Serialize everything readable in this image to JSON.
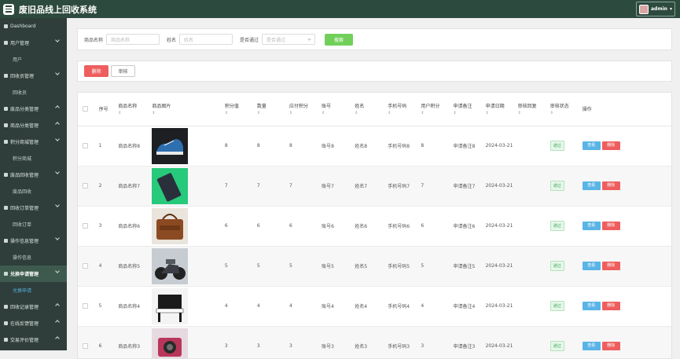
{
  "app": {
    "title": "废旧品线上回收系统",
    "user": "admin"
  },
  "sidebar": {
    "items": [
      {
        "label": "Dashboard",
        "type": "item",
        "icon": "home-icon"
      },
      {
        "label": "用户管理",
        "type": "group",
        "open": true
      },
      {
        "label": "用户",
        "type": "sub"
      },
      {
        "label": "回收员管理",
        "type": "group",
        "open": true
      },
      {
        "label": "回收员",
        "type": "sub"
      },
      {
        "label": "废品分类管理",
        "type": "group",
        "open": false
      },
      {
        "label": "商品分类管理",
        "type": "group",
        "open": false
      },
      {
        "label": "积分商城管理",
        "type": "group",
        "open": true
      },
      {
        "label": "积分商城",
        "type": "sub"
      },
      {
        "label": "废品回收管理",
        "type": "group",
        "open": true
      },
      {
        "label": "废品回收",
        "type": "sub"
      },
      {
        "label": "回收订单管理",
        "type": "group",
        "open": true
      },
      {
        "label": "回收订单",
        "type": "sub"
      },
      {
        "label": "操作信息管理",
        "type": "group",
        "open": true
      },
      {
        "label": "操作信息",
        "type": "sub"
      },
      {
        "label": "兑换申请管理",
        "type": "group",
        "open": true,
        "active": true
      },
      {
        "label": "兑换申请",
        "type": "sub",
        "active": true
      },
      {
        "label": "回收记录管理",
        "type": "group",
        "open": false
      },
      {
        "label": "在线反馈管理",
        "type": "group",
        "open": false
      },
      {
        "label": "交易评价管理",
        "type": "group",
        "open": false
      }
    ]
  },
  "search": {
    "name_label": "商品名称",
    "name_placeholder": "商品名称",
    "person_label": "姓名",
    "person_placeholder": "姓名",
    "pass_label": "是否通过",
    "pass_placeholder": "是否通过",
    "search_button": "搜索"
  },
  "actions": {
    "delete": "删除",
    "review": "审核"
  },
  "table": {
    "headers": [
      "序号",
      "商品名称",
      "商品图片",
      "积分值",
      "数量",
      "应付积分",
      "账号",
      "姓名",
      "手机号码",
      "用户积分",
      "申请备注",
      "申请日期",
      "审核回复",
      "审核状态",
      "操作"
    ],
    "sort_glyph": "⇕",
    "rows": [
      {
        "idx": "1",
        "name": "商品名称8",
        "img": "sneaker",
        "pts": "8",
        "qty": "8",
        "pay": "8",
        "acct": "账号8",
        "person": "姓名8",
        "phone": "手机号码8",
        "upts": "8",
        "note": "申请备注8",
        "date": "2024-03-21",
        "reply": "",
        "status": "通过"
      },
      {
        "idx": "2",
        "name": "商品名称7",
        "img": "tablet",
        "pts": "7",
        "qty": "7",
        "pay": "7",
        "acct": "账号7",
        "person": "姓名7",
        "phone": "手机号码7",
        "upts": "7",
        "note": "申请备注7",
        "date": "2024-03-21",
        "reply": "",
        "status": "通过"
      },
      {
        "idx": "3",
        "name": "商品名称6",
        "img": "bag",
        "pts": "6",
        "qty": "6",
        "pay": "6",
        "acct": "账号6",
        "person": "姓名6",
        "phone": "手机号码6",
        "upts": "6",
        "note": "申请备注6",
        "date": "2024-03-21",
        "reply": "",
        "status": "通过"
      },
      {
        "idx": "4",
        "name": "商品名称5",
        "img": "motorbike",
        "pts": "5",
        "qty": "5",
        "pay": "5",
        "acct": "账号5",
        "person": "姓名5",
        "phone": "手机号码5",
        "upts": "5",
        "note": "申请备注5",
        "date": "2024-03-21",
        "reply": "",
        "status": "通过"
      },
      {
        "idx": "5",
        "name": "商品名称4",
        "img": "piano",
        "pts": "4",
        "qty": "4",
        "pay": "4",
        "acct": "账号4",
        "person": "姓名4",
        "phone": "手机号码4",
        "upts": "4",
        "note": "申请备注4",
        "date": "2024-03-21",
        "reply": "",
        "status": "通过"
      },
      {
        "idx": "6",
        "name": "商品名称3",
        "img": "camera",
        "pts": "3",
        "qty": "3",
        "pay": "3",
        "acct": "账号3",
        "person": "姓名3",
        "phone": "手机号码3",
        "upts": "3",
        "note": "申请备注3",
        "date": "2024-03-21",
        "reply": "",
        "status": "通过"
      }
    ],
    "view_label": "查看",
    "delete_label": "删除"
  },
  "colors": {
    "topbar": "#2d4a3e",
    "sidebar": "#2f3e3a",
    "search": "#72d05a",
    "danger": "#ee5e5e",
    "info": "#5ab4e6"
  }
}
